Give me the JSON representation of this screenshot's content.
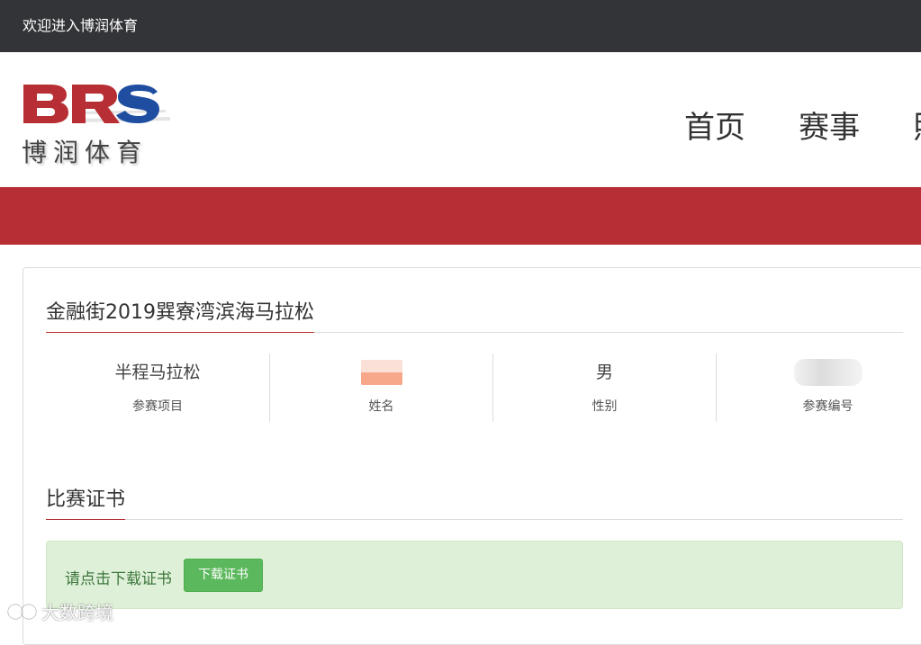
{
  "topbar": {
    "welcome": "欢迎进入博润体育"
  },
  "logo": {
    "letters": "BRS",
    "text": "博润体育"
  },
  "nav": {
    "items": [
      {
        "label": "首页"
      },
      {
        "label": "赛事"
      },
      {
        "label": "照"
      }
    ]
  },
  "event": {
    "title": "金融街2019巽寮湾滨海马拉松",
    "fields": [
      {
        "value": "半程马拉松",
        "label": "参赛项目"
      },
      {
        "value": "",
        "label": "姓名"
      },
      {
        "value": "男",
        "label": "性别"
      },
      {
        "value": "",
        "label": "参赛编号"
      }
    ]
  },
  "certificate": {
    "title": "比赛证书",
    "prompt": "请点击下载证书",
    "download_label": "下载证书"
  },
  "watermark": {
    "text": "大数跨境"
  },
  "colors": {
    "topbar_bg": "#333438",
    "brand_red": "#b72f34",
    "logo_blue": "#1f4ea1",
    "success_bg": "#dff0d8",
    "success_text": "#3c763d",
    "button_green": "#5cb85c"
  }
}
